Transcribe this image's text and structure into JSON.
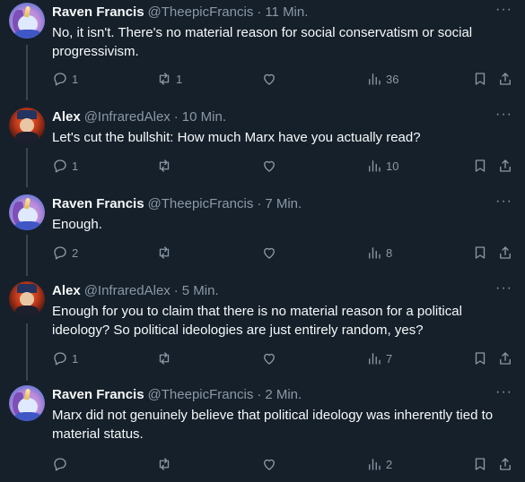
{
  "tweets": [
    {
      "name": "Raven Francis",
      "handle": "@TheepicFrancis",
      "time": "11 Min.",
      "text": "No, it isn't. There's no material reason for social conservatism or social progressivism.",
      "replies": "1",
      "retweets": "1",
      "likes": "",
      "views": "36",
      "avatar": "raven"
    },
    {
      "name": "Alex",
      "handle": "@InfraredAlex",
      "time": "10 Min.",
      "text": "Let's cut the bullshit: How much Marx have you actually read?",
      "replies": "1",
      "retweets": "",
      "likes": "",
      "views": "10",
      "avatar": "alex"
    },
    {
      "name": "Raven Francis",
      "handle": "@TheepicFrancis",
      "time": "7 Min.",
      "text": "Enough.",
      "replies": "2",
      "retweets": "",
      "likes": "",
      "views": "8",
      "avatar": "raven"
    },
    {
      "name": "Alex",
      "handle": "@InfraredAlex",
      "time": "5 Min.",
      "text": "Enough for you to claim that there is no material reason for a political ideology? So political ideologies are just entirely random, yes?",
      "replies": "1",
      "retweets": "",
      "likes": "",
      "views": "7",
      "avatar": "alex"
    },
    {
      "name": "Raven Francis",
      "handle": "@TheepicFrancis",
      "time": "2 Min.",
      "text": "Marx did not genuinely believe that political ideology was inherently tied to material status.",
      "replies": "",
      "retweets": "",
      "likes": "",
      "views": "2",
      "avatar": "raven"
    }
  ],
  "separator": "·",
  "more_glyph": "···",
  "icons": {
    "reply": "reply-icon",
    "retweet": "retweet-icon",
    "like": "heart-icon",
    "views": "views-icon",
    "bookmark": "bookmark-icon",
    "share": "share-icon",
    "more": "more-icon"
  },
  "colors": {
    "background": "#15202b",
    "text": "#f7f9f9",
    "secondary": "#8b98a5",
    "thread_line": "#38444d"
  }
}
